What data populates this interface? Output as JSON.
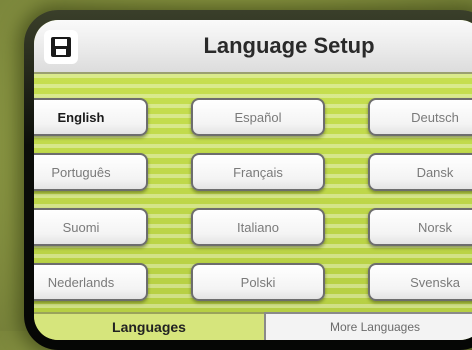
{
  "header": {
    "title": "Language Setup",
    "back_icon": "save-back-icon"
  },
  "languages": [
    {
      "label": "English",
      "selected": true
    },
    {
      "label": "Español",
      "selected": false
    },
    {
      "label": "Deutsch",
      "selected": false
    },
    {
      "label": "Português",
      "selected": false
    },
    {
      "label": "Français",
      "selected": false
    },
    {
      "label": "Dansk",
      "selected": false
    },
    {
      "label": "Suomi",
      "selected": false
    },
    {
      "label": "Italiano",
      "selected": false
    },
    {
      "label": "Norsk",
      "selected": false
    },
    {
      "label": "Nederlands",
      "selected": false
    },
    {
      "label": "Polski",
      "selected": false
    },
    {
      "label": "Svenska",
      "selected": false
    }
  ],
  "tabs": {
    "active_label": "Languages",
    "inactive_label": "More Languages"
  },
  "colors": {
    "accent": "#b7d24a",
    "check": "#8fc22e"
  }
}
